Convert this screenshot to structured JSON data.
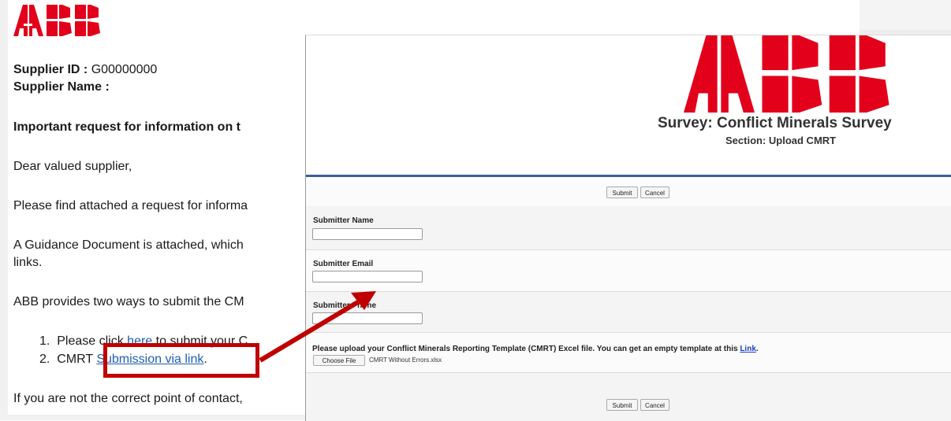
{
  "email": {
    "logo_text": "ABB",
    "supplier_id_label": "Supplier ID :",
    "supplier_id_value": "G00000000",
    "supplier_name_label": "Supplier Name :",
    "important": "Important request for information on t",
    "greeting": "Dear valued supplier,",
    "para1": "Please find attached a request for informa",
    "para2_line1": "A Guidance Document is attached, which",
    "para2_line2": "links.",
    "para3": "ABB provides two ways to submit the CM",
    "item1_num": "1.",
    "item1_pre": "Please click",
    "item1_link": "here",
    "item1_post": "to submit your C",
    "item2_num": "2.",
    "item2_pre": "CMRT",
    "item2_link": "Submission via link",
    "item2_post": ".",
    "footer": "If you are not the correct point of contact,"
  },
  "form": {
    "logo_text": "ABB",
    "survey_title": "Survey: Conflict Minerals Survey",
    "section_title": "Section: Upload CMRT",
    "submit_label": "Submit",
    "cancel_label": "Cancel",
    "fields": [
      {
        "label": "Submitter Name",
        "value": ""
      },
      {
        "label": "Submitter Email",
        "value": ""
      },
      {
        "label": "Submitter Phone",
        "value": ""
      }
    ],
    "upload_text": "Please upload your Conflict Minerals Reporting Template (CMRT) Excel file. You can get an empty template at this",
    "upload_link": "Link",
    "upload_link_post": ".",
    "choose_file_label": "Choose File",
    "file_name": "CMRT Without Errors.xlsx"
  },
  "colors": {
    "abb_red": "#e2001a",
    "highlight_red": "#c00000",
    "link_blue": "#1f5fb0",
    "section_blue": "#3a5f9e"
  }
}
